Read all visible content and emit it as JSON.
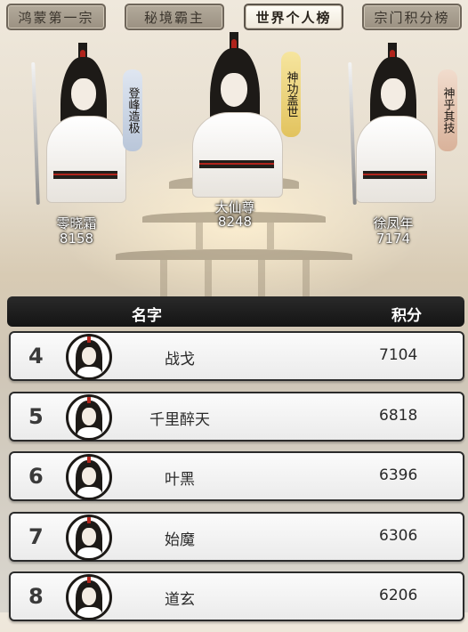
{
  "tabs": [
    {
      "label": "鸿蒙第一宗",
      "active": false
    },
    {
      "label": "秘境霸主",
      "active": false
    },
    {
      "label": "世界个人榜",
      "active": true
    },
    {
      "label": "宗门积分榜",
      "active": false
    }
  ],
  "podium": [
    {
      "rank": 2,
      "name": "零晓霜",
      "score": "8158",
      "title": "登峰造极",
      "title_color": "#c9d3e3"
    },
    {
      "rank": 1,
      "name": "大仙尊",
      "score": "8248",
      "title": "神功盖世",
      "title_color": "#f0d98a"
    },
    {
      "rank": 3,
      "name": "徐凤年",
      "score": "7174",
      "title": "神乎其技",
      "title_color": "#e8c7b0"
    }
  ],
  "table": {
    "header_name": "名字",
    "header_score": "积分",
    "rows": [
      {
        "rank": "4",
        "name": "战戈",
        "score": "7104"
      },
      {
        "rank": "5",
        "name": "千里醉天",
        "score": "6818"
      },
      {
        "rank": "6",
        "name": "叶黑",
        "score": "6396"
      },
      {
        "rank": "7",
        "name": "始魔",
        "score": "6306"
      },
      {
        "rank": "8",
        "name": "道玄",
        "score": "6206"
      }
    ]
  },
  "colors": {
    "accent_red": "#b0241c",
    "header_bg": "#1a1a1a"
  }
}
